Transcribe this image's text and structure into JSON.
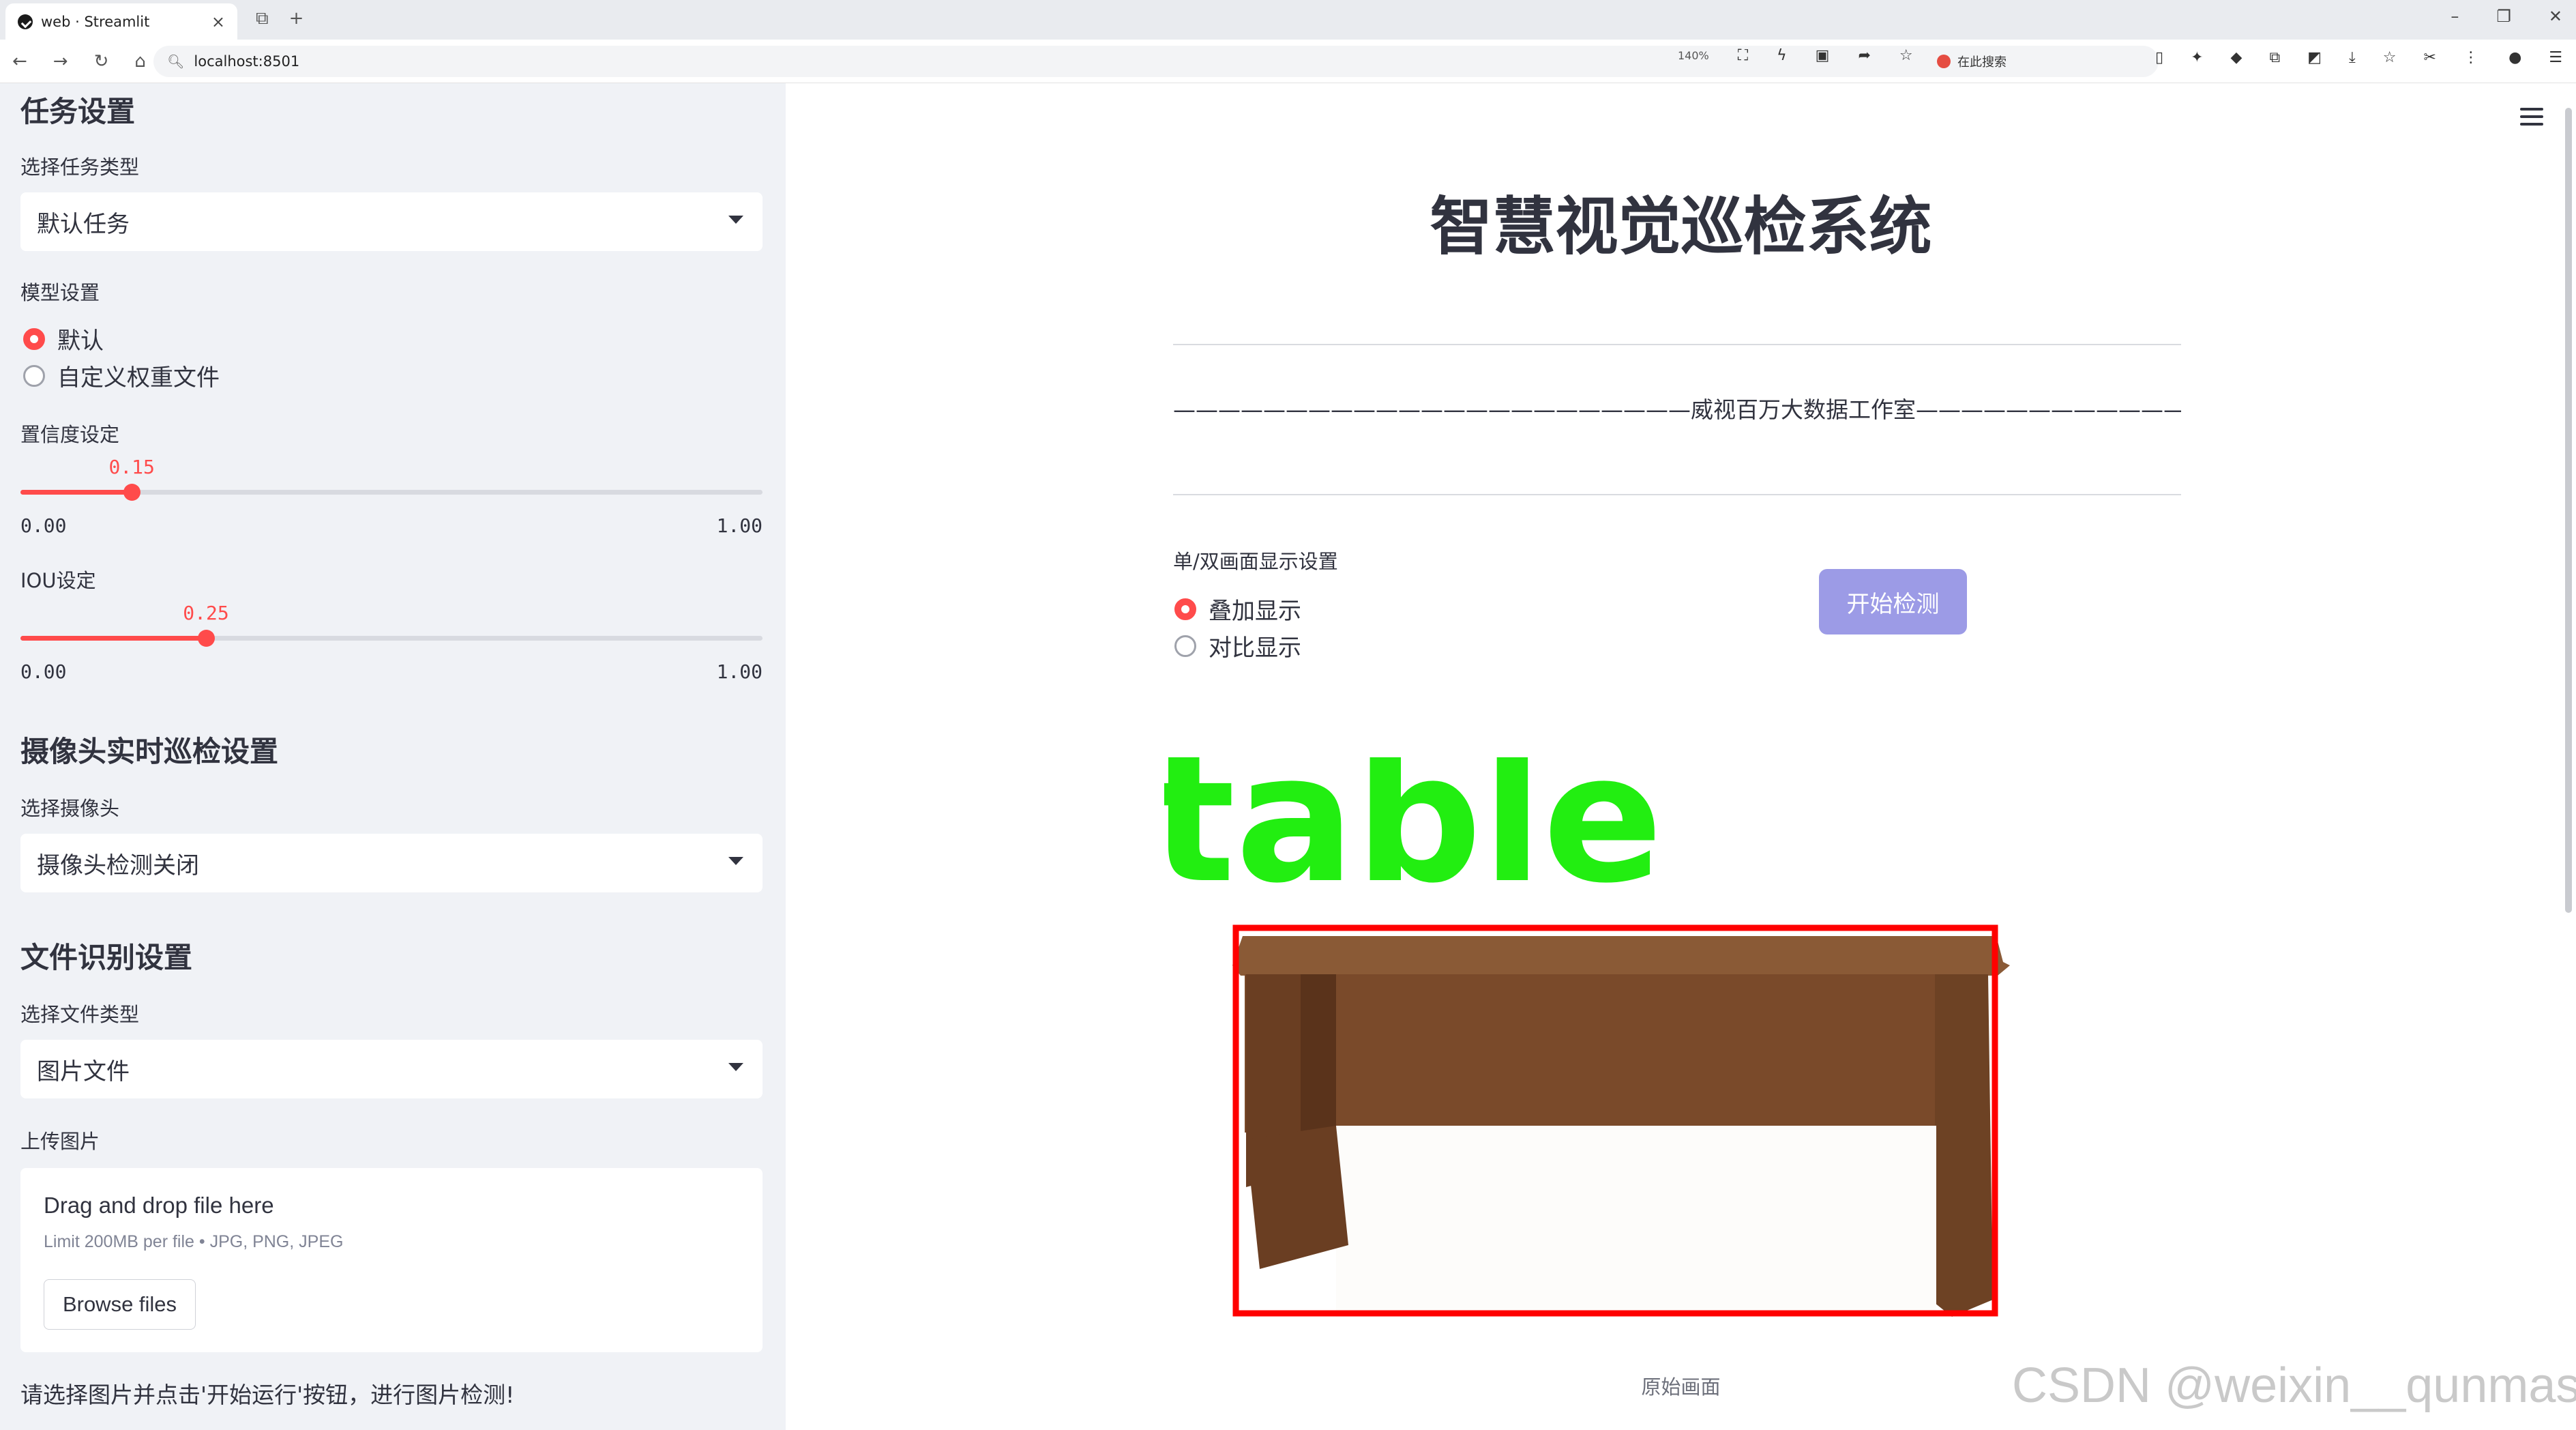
{
  "browser": {
    "tab_title": "web · Streamlit",
    "tab_close": "×",
    "new_tab_icons": [
      "⧉",
      "+"
    ],
    "window_controls": [
      "–",
      "❐",
      "✕"
    ],
    "url": "localhost:8501",
    "zoom": "140%",
    "search_engine_text": "在此搜索"
  },
  "sidebar": {
    "task_section_title": "任务设置",
    "task_type_label": "选择任务类型",
    "task_type_value": "默认任务",
    "model_label": "模型设置",
    "model_options": [
      "默认",
      "自定义权重文件"
    ],
    "model_selected": "默认",
    "confidence_label": "置信度设定",
    "confidence": {
      "value": 0.15,
      "value_text": "0.15",
      "min": "0.00",
      "max": "1.00"
    },
    "iou_label": "IOU设定",
    "iou": {
      "value": 0.25,
      "value_text": "0.25",
      "min": "0.00",
      "max": "1.00"
    },
    "camera_section_title": "摄像头实时巡检设置",
    "camera_label": "选择摄像头",
    "camera_value": "摄像头检测关闭",
    "file_section_title": "文件识别设置",
    "file_type_label": "选择文件类型",
    "file_type_value": "图片文件",
    "upload_label": "上传图片",
    "upload_title": "Drag and drop file here",
    "upload_limit": "Limit 200MB per file • JPG, PNG, JPEG",
    "upload_button": "Browse files",
    "note": "请选择图片并点击'开始运行'按钮，进行图片检测!"
  },
  "main": {
    "title": "智慧视觉巡检系统",
    "studio_line": "———————————————————————威视百万大数据工作室————————————————————————",
    "display_label": "单/双画面显示设置",
    "display_options": [
      "叠加显示",
      "对比显示"
    ],
    "display_selected": "叠加显示",
    "start_button": "开始检测",
    "detection_label": "table",
    "caption": "原始画面",
    "watermark": "CSDN @weixin__qunmasj"
  },
  "colors": {
    "accent": "#ff4b4b",
    "button": "#9c9be6",
    "label_green": "#22ee11",
    "bbox_red": "#ff0000",
    "table_brown": "#7a4a2a"
  }
}
